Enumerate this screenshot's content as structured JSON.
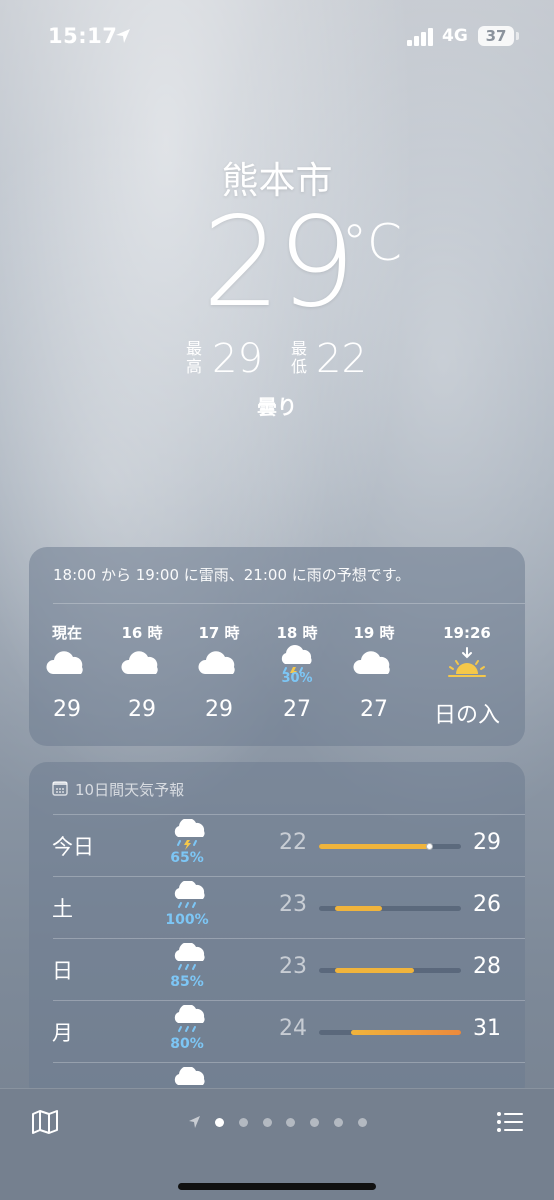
{
  "status_bar": {
    "time": "15:17",
    "network": "4G",
    "battery": "37"
  },
  "current": {
    "city": "熊本市",
    "temperature": "29",
    "unit": "°C",
    "high_label": "最高",
    "high": "29",
    "low_label": "最低",
    "low": "22",
    "condition": "曇り"
  },
  "hourly": {
    "summary": "18:00 から 19:00 に雷雨、21:00 に雨の予想です。",
    "items": [
      {
        "label": "現在",
        "icon": "cloud-icon",
        "pop": "",
        "temp": "29"
      },
      {
        "label": "16 時",
        "icon": "cloud-icon",
        "pop": "",
        "temp": "29"
      },
      {
        "label": "17 時",
        "icon": "cloud-icon",
        "pop": "",
        "temp": "29"
      },
      {
        "label": "18 時",
        "icon": "thunderstorm-icon",
        "pop": "30%",
        "temp": "27"
      },
      {
        "label": "19 時",
        "icon": "cloud-icon",
        "pop": "",
        "temp": "27"
      },
      {
        "label": "19:26",
        "icon": "sunset-icon",
        "pop": "",
        "temp": "日の入"
      }
    ]
  },
  "daily": {
    "title": "10日間天気予報",
    "range": [
      22,
      31
    ],
    "items": [
      {
        "day": "今日",
        "icon": "thunderstorm-icon",
        "pop": "65%",
        "low": "22",
        "high": "29",
        "current": 29
      },
      {
        "day": "土",
        "icon": "rain-icon",
        "pop": "100%",
        "low": "23",
        "high": "26"
      },
      {
        "day": "日",
        "icon": "rain-icon",
        "pop": "85%",
        "low": "23",
        "high": "28"
      },
      {
        "day": "月",
        "icon": "rain-icon",
        "pop": "80%",
        "low": "24",
        "high": "31"
      }
    ]
  },
  "colors": {
    "pop_blue": "#7dc6f5",
    "bar_warm": "#f0b43c",
    "bar_hot": "#ec8a3c"
  },
  "bottom_bar": {
    "map_icon": "map-icon",
    "location_icon": "location-arrow-icon",
    "list_icon": "list-icon",
    "pages": 7,
    "active_page": 1
  }
}
